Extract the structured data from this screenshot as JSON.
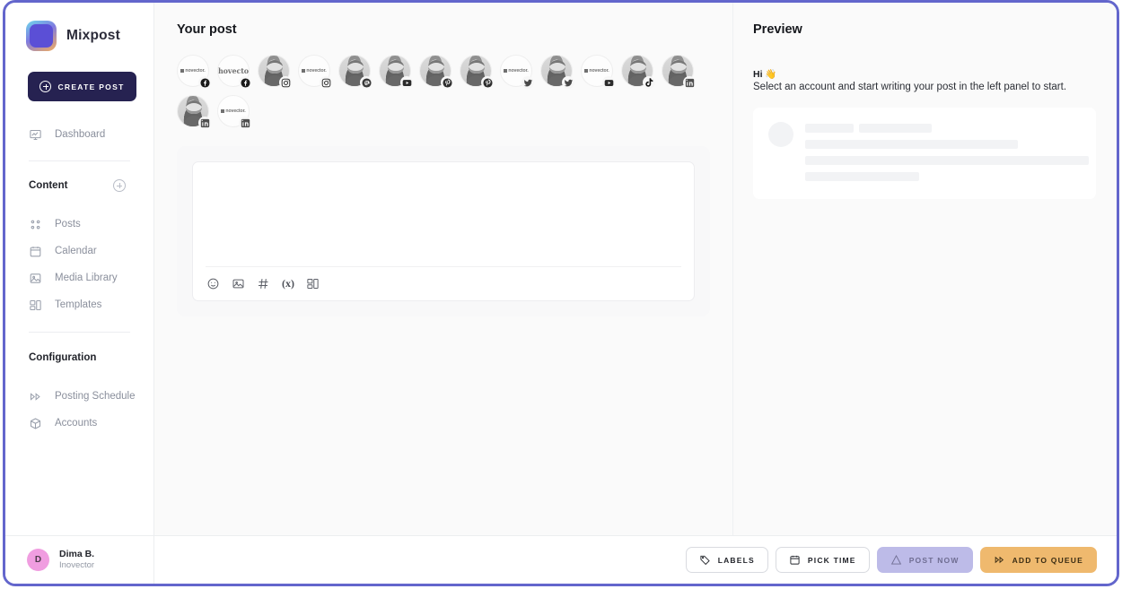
{
  "app": {
    "brand": "Mixpost",
    "logo_icon": "mixpost-logo-icon"
  },
  "sidebar": {
    "create_button": {
      "label": "CREATE POST",
      "icon": "plus-circle-icon"
    },
    "primary": [
      {
        "label": "Dashboard",
        "icon": "dashboard-icon"
      }
    ],
    "sections": [
      {
        "title": "Content",
        "add_icon": "plus-circle-icon",
        "items": [
          {
            "label": "Posts",
            "icon": "posts-icon"
          },
          {
            "label": "Calendar",
            "icon": "calendar-icon"
          },
          {
            "label": "Media Library",
            "icon": "media-library-icon"
          },
          {
            "label": "Templates",
            "icon": "templates-icon"
          }
        ]
      },
      {
        "title": "Configuration",
        "items": [
          {
            "label": "Posting Schedule",
            "icon": "posting-schedule-icon"
          },
          {
            "label": "Accounts",
            "icon": "accounts-icon"
          }
        ]
      }
    ],
    "user": {
      "initial": "D",
      "name": "Dima B.",
      "organization": "Inovector",
      "avatar_color": "#f09de0"
    }
  },
  "post_panel": {
    "title": "Your post",
    "accounts": [
      {
        "provider": "facebook",
        "avatar": "inovector-logo"
      },
      {
        "provider": "facebook",
        "avatar": "hovector-wordmark"
      },
      {
        "provider": "instagram",
        "avatar": "person-photo"
      },
      {
        "provider": "instagram",
        "avatar": "inovector-logo"
      },
      {
        "provider": "mastodon",
        "avatar": "person-photo"
      },
      {
        "provider": "youtube",
        "avatar": "person-photo"
      },
      {
        "provider": "pinterest",
        "avatar": "person-photo"
      },
      {
        "provider": "pinterest",
        "avatar": "person-photo"
      },
      {
        "provider": "twitter",
        "avatar": "inovector-logo"
      },
      {
        "provider": "twitter",
        "avatar": "person-photo"
      },
      {
        "provider": "youtube",
        "avatar": "inovector-logo"
      },
      {
        "provider": "tiktok",
        "avatar": "person-photo"
      },
      {
        "provider": "linkedin",
        "avatar": "person-photo"
      },
      {
        "provider": "linkedin",
        "avatar": "person-photo"
      },
      {
        "provider": "linkedin",
        "avatar": "inovector-logo"
      }
    ],
    "editor": {
      "content": "",
      "placeholder": "",
      "tools": [
        {
          "name": "emoji-icon",
          "label": "Emoji"
        },
        {
          "name": "image-icon",
          "label": "Media"
        },
        {
          "name": "hashtag-icon",
          "label": "Hashtag"
        },
        {
          "name": "variable-icon",
          "label": "(x)"
        },
        {
          "name": "template-icon",
          "label": "Template"
        }
      ]
    }
  },
  "preview": {
    "title": "Preview",
    "greeting": "Hi 👋",
    "message": "Select an account and start writing your post in the left panel to start."
  },
  "footer": {
    "buttons": [
      {
        "label": "LABELS",
        "icon": "tag-icon",
        "style": "outline"
      },
      {
        "label": "PICK TIME",
        "icon": "calendar-icon",
        "style": "outline"
      },
      {
        "label": "POST NOW",
        "icon": "send-icon",
        "style": "purple"
      },
      {
        "label": "ADD TO QUEUE",
        "icon": "queue-icon",
        "style": "orange"
      }
    ]
  },
  "colors": {
    "window_border": "#6366cc",
    "create_button": "#262251",
    "post_now": "#bdbbe8",
    "add_to_queue": "#efb96e",
    "brand_purple": "#5b4fd6"
  }
}
